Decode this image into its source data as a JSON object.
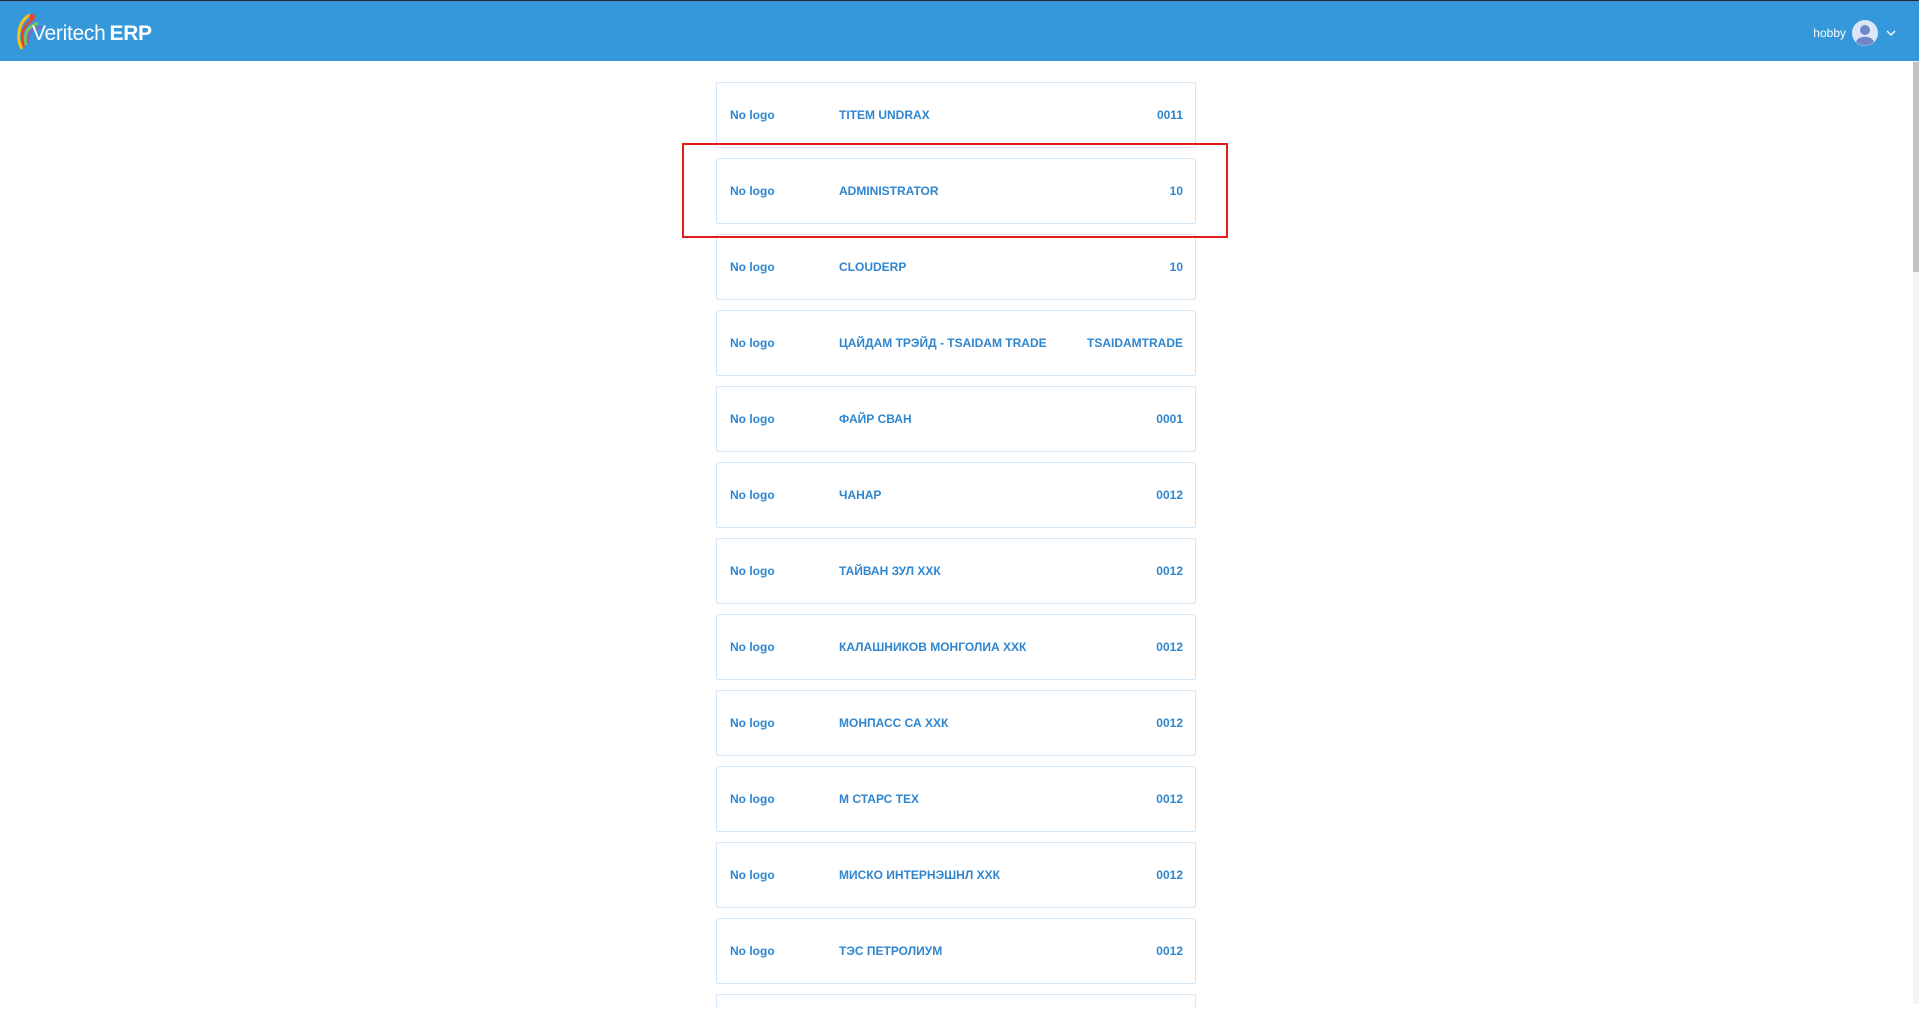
{
  "header": {
    "brand": "Veritech",
    "product": "ERP",
    "user_name": "hobby",
    "accent_color": "#3498db"
  },
  "companies": [
    {
      "logo": "No logo",
      "name": "TITEM UNDRAX",
      "code": "0011"
    },
    {
      "logo": "No logo",
      "name": "ADMINISTRATOR",
      "code": "10"
    },
    {
      "logo": "No logo",
      "name": "CLOUDERP",
      "code": "10"
    },
    {
      "logo": "No logo",
      "name": "ЦАЙДАМ ТРЭЙД - TSAIDAM TRADE",
      "code": "TSAIDAMTRADE"
    },
    {
      "logo": "No logo",
      "name": "ФАЙР СВАН",
      "code": "0001"
    },
    {
      "logo": "No logo",
      "name": "ЧАНАР",
      "code": "0012"
    },
    {
      "logo": "No logo",
      "name": "ТАЙВАН ЗУЛ ХХК",
      "code": "0012"
    },
    {
      "logo": "No logo",
      "name": "КАЛАШНИКОВ МОНГОЛИА ХХК",
      "code": "0012"
    },
    {
      "logo": "No logo",
      "name": "МОНПАСС СА ХХК",
      "code": "0012"
    },
    {
      "logo": "No logo",
      "name": "М СТАРС ТЕХ",
      "code": "0012"
    },
    {
      "logo": "No logo",
      "name": "МИСКО ИНТЕРНЭШНЛ ХХК",
      "code": "0012"
    },
    {
      "logo": "No logo",
      "name": "ТЭС ПЕТРОЛИУМ",
      "code": "0012"
    }
  ]
}
